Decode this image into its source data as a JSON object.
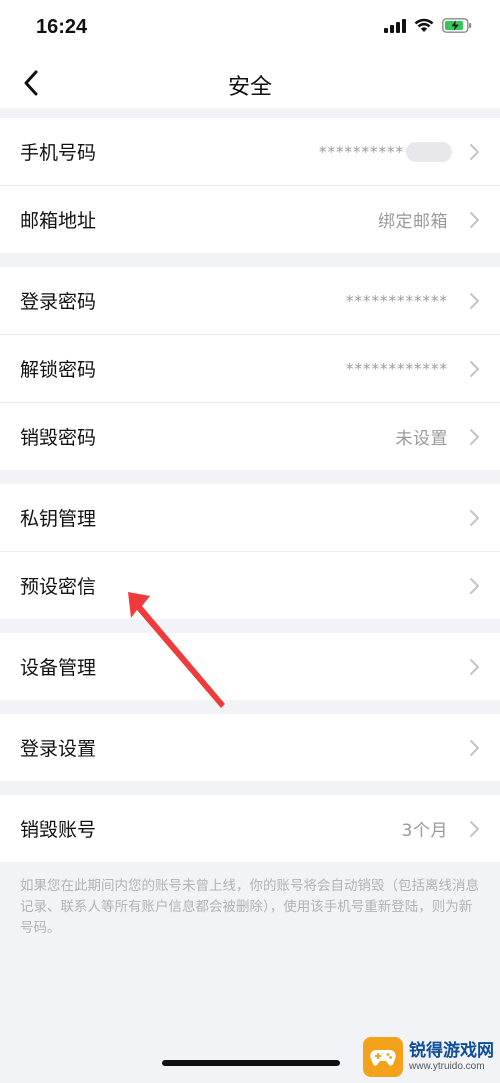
{
  "status": {
    "time": "16:24"
  },
  "nav": {
    "title": "安全"
  },
  "groups": [
    {
      "rows": [
        {
          "label": "手机号码",
          "value": "**********"
        },
        {
          "label": "邮箱地址",
          "value": "绑定邮箱"
        }
      ]
    },
    {
      "rows": [
        {
          "label": "登录密码",
          "value": "************"
        },
        {
          "label": "解锁密码",
          "value": "************"
        },
        {
          "label": "销毁密码",
          "value": "未设置"
        }
      ]
    },
    {
      "rows": [
        {
          "label": "私钥管理",
          "value": ""
        },
        {
          "label": "预设密信",
          "value": ""
        }
      ]
    },
    {
      "rows": [
        {
          "label": "设备管理",
          "value": ""
        }
      ]
    },
    {
      "rows": [
        {
          "label": "登录设置",
          "value": ""
        }
      ]
    },
    {
      "rows": [
        {
          "label": "销毁账号",
          "value": "3个月"
        }
      ]
    }
  ],
  "footnote": "如果您在此期间内您的账号未曾上线，你的账号将会自动销毁（包括离线消息记录、联系人等所有账户信息都会被删除），使用该手机号重新登陆，则为新号码。",
  "watermark": {
    "title": "锐得游戏网",
    "url": "www.ytruido.com"
  },
  "colors": {
    "accent": "#ef3b3b",
    "battery": "#34c759",
    "watermark_badge": "#f4a11c"
  }
}
